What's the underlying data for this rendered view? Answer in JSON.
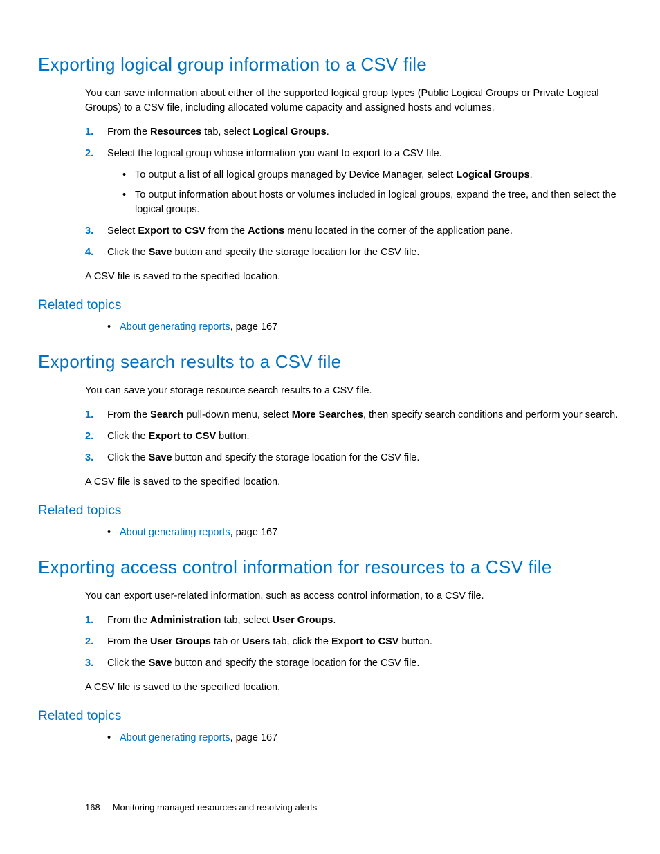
{
  "section1": {
    "title": "Exporting logical group information to a CSV file",
    "intro": "You can save information about either of the supported logical group types (Public Logical Groups or Private Logical Groups) to a CSV file, including allocated volume capacity and assigned hosts and volumes.",
    "step1_pre": "From the ",
    "step1_b1": "Resources",
    "step1_mid": " tab, select ",
    "step1_b2": "Logical Groups",
    "step1_post": ".",
    "step2": "Select the logical group whose information you want to export to a CSV file.",
    "step2_sub1_pre": "To output a list of all logical groups managed by Device Manager, select ",
    "step2_sub1_b": "Logical Groups",
    "step2_sub1_post": ".",
    "step2_sub2": "To output information about hosts or volumes included in logical groups, expand the tree, and then select the logical groups.",
    "step3_pre": "Select ",
    "step3_b1": "Export to CSV",
    "step3_mid": " from the ",
    "step3_b2": "Actions",
    "step3_post": " menu located in the corner of the application pane.",
    "step4_pre": "Click the ",
    "step4_b": "Save",
    "step4_post": " button and specify the storage location for the CSV file.",
    "outro": "A CSV file is saved to the specified location.",
    "related_heading": "Related topics",
    "related_link": "About generating reports",
    "related_suffix": ", page 167"
  },
  "section2": {
    "title": "Exporting search results to a CSV file",
    "intro": "You can save your storage resource search results to a CSV file.",
    "step1_pre": "From the ",
    "step1_b1": "Search",
    "step1_mid": " pull-down menu, select ",
    "step1_b2": "More Searches",
    "step1_post": ", then specify search conditions and perform your search.",
    "step2_pre": "Click the ",
    "step2_b": "Export to CSV",
    "step2_post": " button.",
    "step3_pre": "Click the ",
    "step3_b": "Save",
    "step3_post": " button and specify the storage location for the CSV file.",
    "outro": "A CSV file is saved to the specified location.",
    "related_heading": "Related topics",
    "related_link": "About generating reports",
    "related_suffix": ", page 167"
  },
  "section3": {
    "title": "Exporting access control information for resources to a CSV file",
    "intro": "You can export user-related information, such as access control information, to a CSV file.",
    "step1_pre": "From the ",
    "step1_b1": "Administration",
    "step1_mid": " tab, select ",
    "step1_b2": "User Groups",
    "step1_post": ".",
    "step2_pre": "From the ",
    "step2_b1": "User Groups",
    "step2_mid": " tab or ",
    "step2_b2": "Users",
    "step2_mid2": " tab, click the ",
    "step2_b3": "Export to CSV",
    "step2_post": " button.",
    "step3_pre": "Click the ",
    "step3_b": "Save",
    "step3_post": " button and specify the storage location for the CSV file.",
    "outro": "A CSV file is saved to the specified location.",
    "related_heading": "Related topics",
    "related_link": "About generating reports",
    "related_suffix": ", page 167"
  },
  "footer": {
    "page": "168",
    "title": "Monitoring managed resources and resolving alerts"
  },
  "labels": {
    "n1": "1.",
    "n2": "2.",
    "n3": "3.",
    "n4": "4."
  }
}
